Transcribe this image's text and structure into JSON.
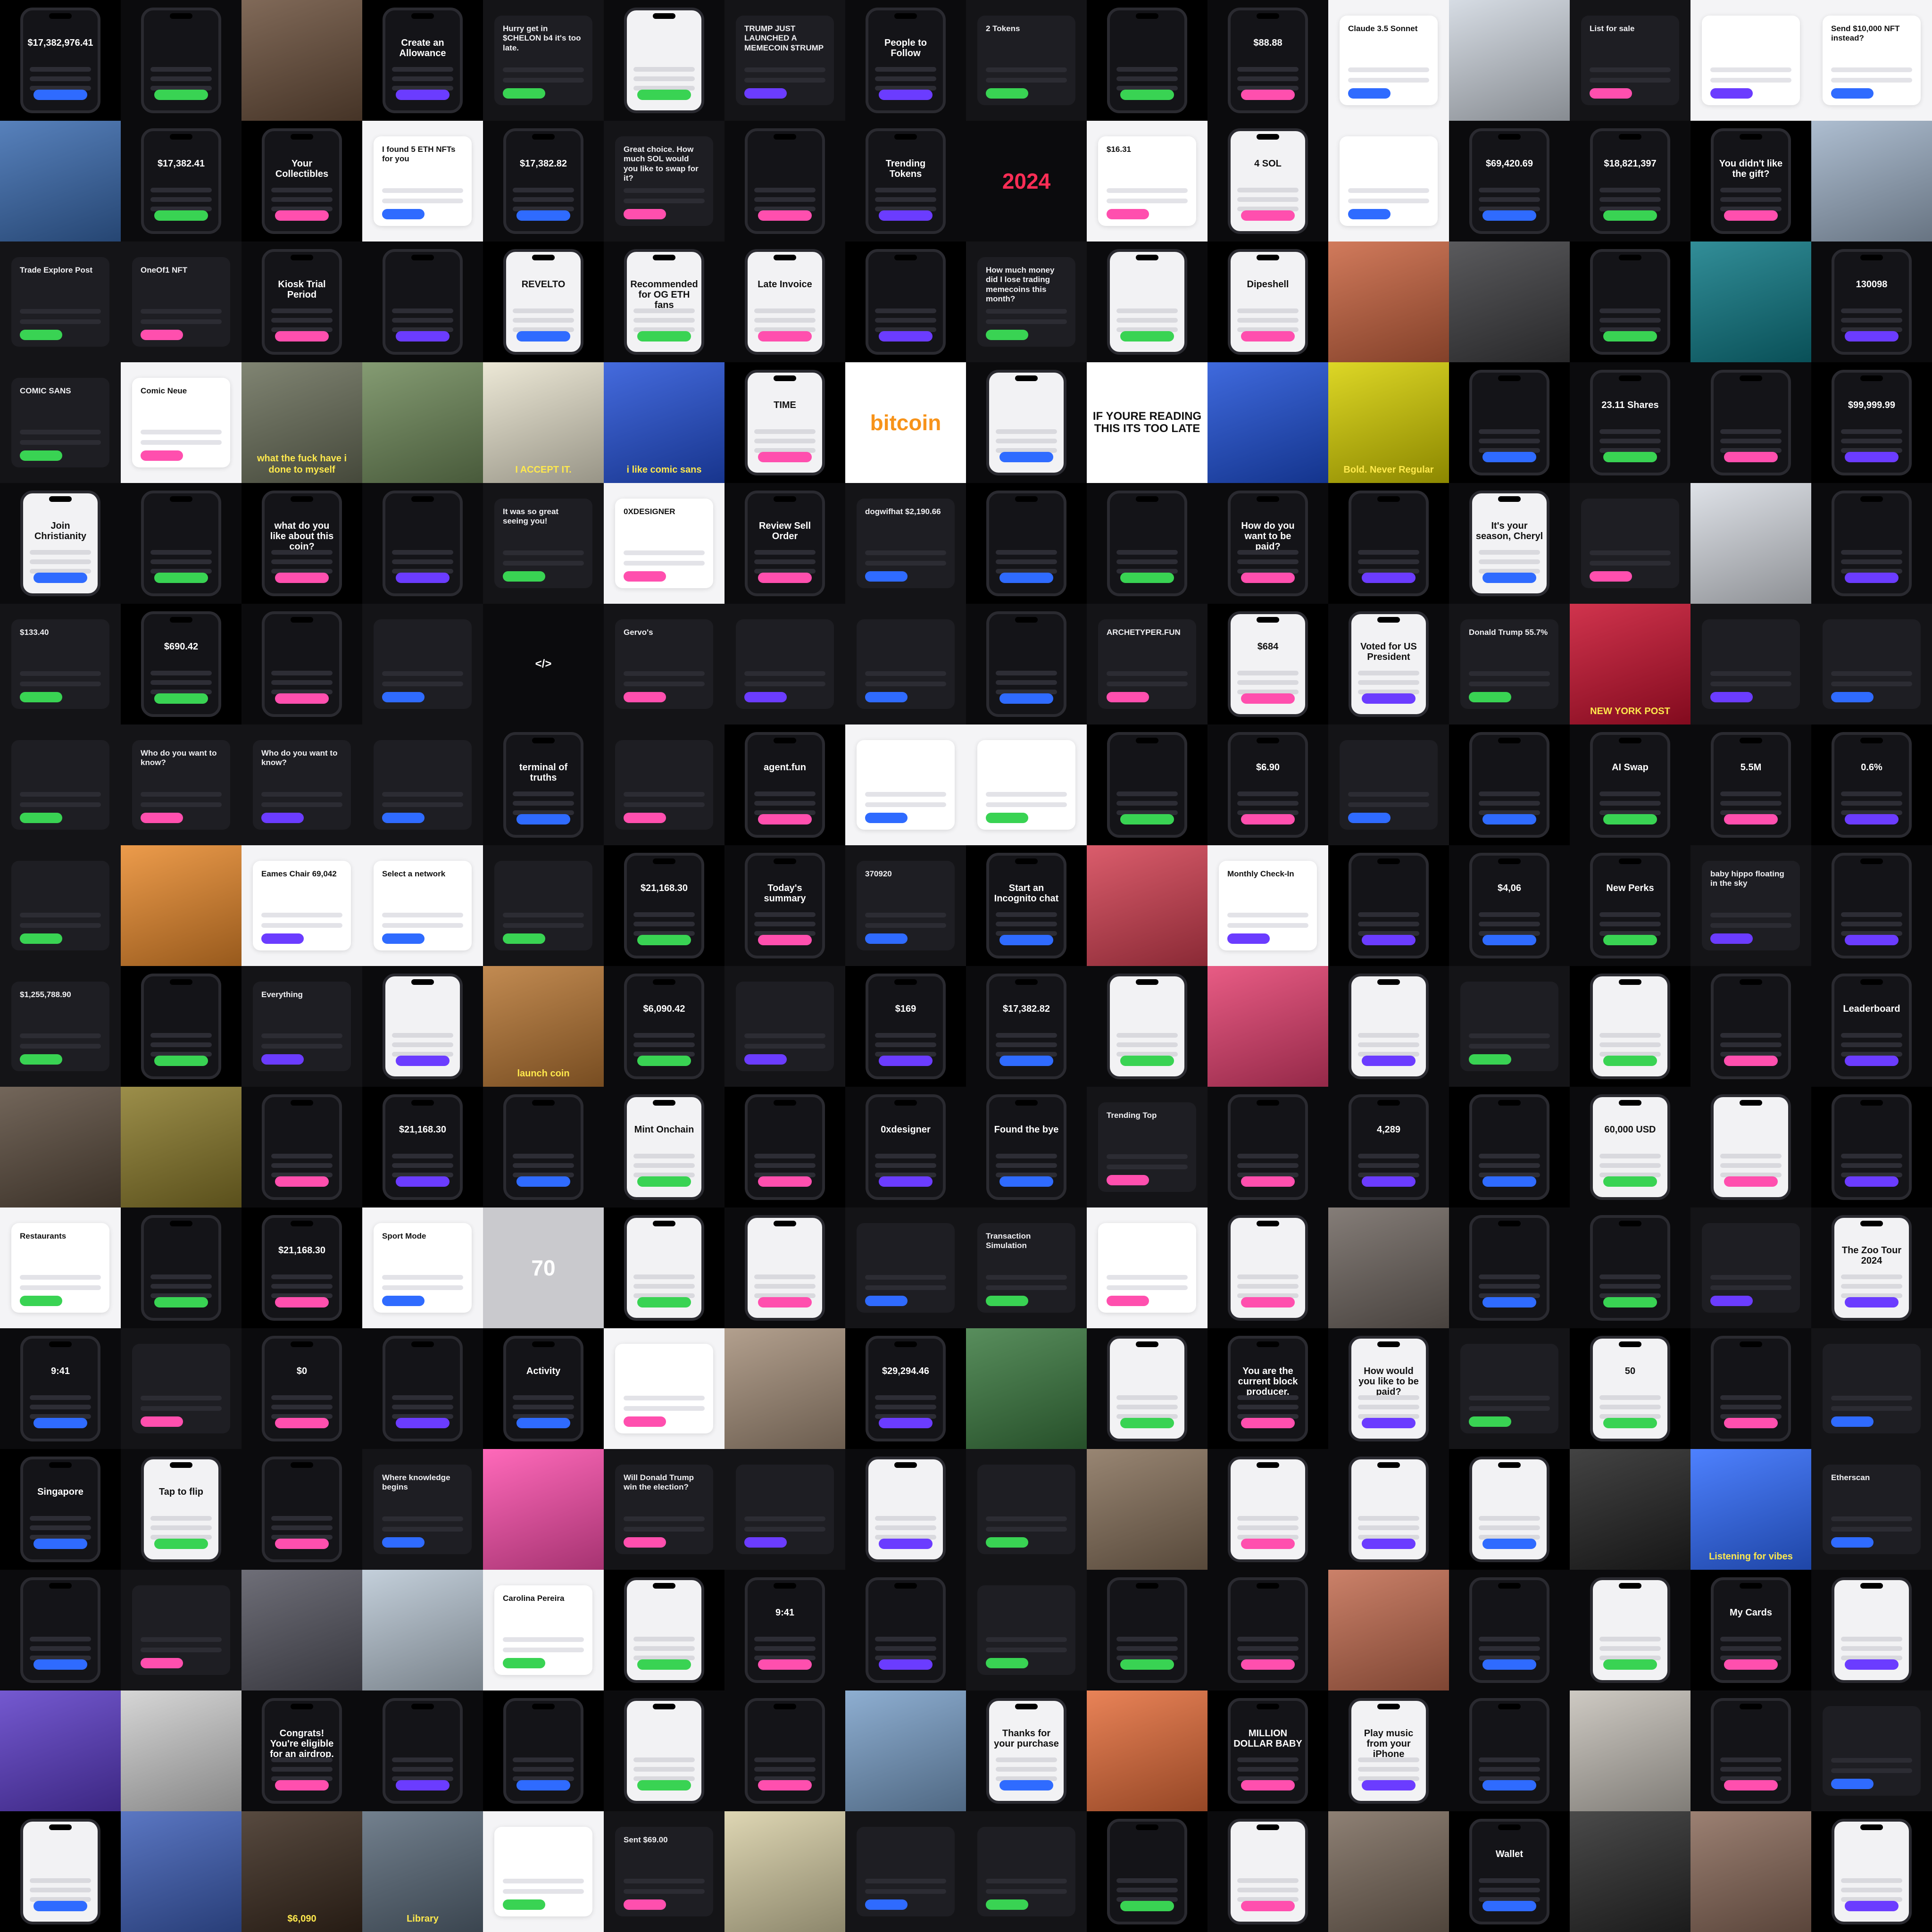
{
  "colors": {
    "background": "#000000",
    "accent_blue": "#2f6bff",
    "accent_green": "#39d353",
    "accent_pink": "#ff4fae",
    "accent_purple": "#6b3cff",
    "accent_orange": "#f7931a"
  },
  "tiles": [
    {
      "style": "phone",
      "text": "$17,382,976.41"
    },
    {
      "style": "phone",
      "text": ""
    },
    {
      "style": "photo",
      "bg": "#6a4f3b",
      "text": ""
    },
    {
      "style": "phone",
      "text": "Create an Allowance"
    },
    {
      "style": "card",
      "text": "Hurry get in $CHELON b4 it's too late."
    },
    {
      "style": "phone-light",
      "text": ""
    },
    {
      "style": "card",
      "text": "TRUMP JUST LAUNCHED A MEMECOIN $TRUMP"
    },
    {
      "style": "phone",
      "text": "People to Follow"
    },
    {
      "style": "card",
      "text": "2 Tokens"
    },
    {
      "style": "phone",
      "text": ""
    },
    {
      "style": "phone",
      "text": "$88.88"
    },
    {
      "style": "card-light",
      "text": "Claude 3.5 Sonnet"
    },
    {
      "style": "photo",
      "bg": "#cfd6df",
      "text": ""
    },
    {
      "style": "card",
      "text": "List for sale"
    },
    {
      "style": "card-light",
      "text": ""
    },
    {
      "style": "card-light",
      "text": "Send $10,000 NFT instead?"
    },
    {
      "style": "photo",
      "bg": "#3a6bb0",
      "text": ""
    },
    {
      "style": "phone",
      "text": "$17,382.41"
    },
    {
      "style": "phone",
      "text": "Your Collectibles"
    },
    {
      "style": "card-light",
      "text": "I found 5 ETH NFTs for you"
    },
    {
      "style": "phone",
      "text": "$17,382.82"
    },
    {
      "style": "card",
      "text": "Great choice. How much SOL would you like to swap for it?"
    },
    {
      "style": "phone",
      "text": ""
    },
    {
      "style": "phone",
      "text": "Trending Tokens"
    },
    {
      "style": "big",
      "color": "#ff2d55",
      "text": "2024"
    },
    {
      "style": "card-light",
      "text": "$16.31"
    },
    {
      "style": "phone-light",
      "text": "4 SOL"
    },
    {
      "style": "card-light",
      "text": ""
    },
    {
      "style": "phone",
      "text": "$69,420.69"
    },
    {
      "style": "phone",
      "text": "$18,821,397"
    },
    {
      "style": "phone",
      "text": "You didn't like the gift?"
    },
    {
      "style": "photo",
      "bg": "#9fb2c8",
      "text": ""
    },
    {
      "style": "card",
      "text": "Trade Explore Post"
    },
    {
      "style": "card",
      "text": "OneOf1 NFT"
    },
    {
      "style": "phone",
      "text": "Kiosk Trial Period"
    },
    {
      "style": "phone",
      "text": ""
    },
    {
      "style": "phone-light",
      "text": "REVELTO"
    },
    {
      "style": "phone-light",
      "text": "Recommended for OG ETH fans"
    },
    {
      "style": "phone-light",
      "text": "Late Invoice"
    },
    {
      "style": "phone",
      "text": ""
    },
    {
      "style": "card",
      "text": "How much money did I lose trading memecoins this month?"
    },
    {
      "style": "phone-light",
      "text": ""
    },
    {
      "style": "phone-light",
      "text": "Dipeshell"
    },
    {
      "style": "photo",
      "bg": "#c9633f",
      "text": ""
    },
    {
      "style": "photo",
      "bg": "#3d3d40",
      "text": ""
    },
    {
      "style": "phone",
      "text": ""
    },
    {
      "style": "photo",
      "bg": "#0e7a86",
      "text": ""
    },
    {
      "style": "phone",
      "text": "130098"
    },
    {
      "style": "card",
      "text": "COMIC SANS"
    },
    {
      "style": "card-light",
      "text": "Comic Neue"
    },
    {
      "style": "photo",
      "bg": "#6a6f5a",
      "text": "what the fuck have i done to myself"
    },
    {
      "style": "photo",
      "bg": "#6f8a5a",
      "text": ""
    },
    {
      "style": "photo",
      "bg": "#e9e4cf",
      "text": "I ACCEPT IT."
    },
    {
      "style": "photo",
      "bg": "#2451d8",
      "text": "i like comic sans"
    },
    {
      "style": "phone-light",
      "text": "TIME"
    },
    {
      "style": "big",
      "color": "#f7931a",
      "bg": "#ffffff",
      "text": "bitcoin"
    },
    {
      "style": "phone-light",
      "text": ""
    },
    {
      "style": "mid",
      "bg": "#ffffff",
      "color": "#111111",
      "text": "IF YOURE READING THIS ITS TOO LATE"
    },
    {
      "style": "photo",
      "bg": "#1e50d8",
      "text": ""
    },
    {
      "style": "photo",
      "bg": "#d7d000",
      "text": "Bold. Never Regular"
    },
    {
      "style": "phone",
      "text": ""
    },
    {
      "style": "phone",
      "text": "23.11 Shares"
    },
    {
      "style": "phone",
      "text": ""
    },
    {
      "style": "phone",
      "text": "$99,999.99"
    },
    {
      "style": "phone-light",
      "text": "Join Christianity"
    },
    {
      "style": "phone",
      "text": ""
    },
    {
      "style": "phone",
      "text": "what do you like about this coin?"
    },
    {
      "style": "phone",
      "text": ""
    },
    {
      "style": "card",
      "text": "It was so great seeing you!"
    },
    {
      "style": "card-light",
      "text": "0XDESIGNER"
    },
    {
      "style": "phone",
      "text": "Review Sell Order"
    },
    {
      "style": "card",
      "text": "dogwifhat $2,190.66"
    },
    {
      "style": "phone",
      "text": ""
    },
    {
      "style": "phone",
      "text": ""
    },
    {
      "style": "phone",
      "text": "How do you want to be paid?"
    },
    {
      "style": "phone",
      "text": ""
    },
    {
      "style": "phone-light",
      "text": "It's your season, Cheryl"
    },
    {
      "style": "card",
      "text": ""
    },
    {
      "style": "photo",
      "bg": "#d9dde4",
      "text": ""
    },
    {
      "style": "phone",
      "text": ""
    },
    {
      "style": "card",
      "text": "$133.40"
    },
    {
      "style": "phone",
      "text": "$690.42"
    },
    {
      "style": "phone",
      "text": ""
    },
    {
      "style": "card",
      "text": ""
    },
    {
      "style": "mid",
      "bg": "#0b0b0d",
      "color": "#ffffff",
      "text": "</>"
    },
    {
      "style": "card",
      "text": "Gervo's"
    },
    {
      "style": "card",
      "text": ""
    },
    {
      "style": "card",
      "text": ""
    },
    {
      "style": "phone",
      "text": ""
    },
    {
      "style": "card",
      "text": "ARCHETYPER.FUN"
    },
    {
      "style": "phone-light",
      "text": "$684"
    },
    {
      "style": "phone-light",
      "text": "Voted for US President"
    },
    {
      "style": "card",
      "text": "Donald Trump 55.7%"
    },
    {
      "style": "photo",
      "bg": "#c8102e",
      "text": "NEW YORK POST"
    },
    {
      "style": "card",
      "text": ""
    },
    {
      "style": "card",
      "text": ""
    },
    {
      "style": "card",
      "text": ""
    },
    {
      "style": "card",
      "text": "Who do you want to know?"
    },
    {
      "style": "card",
      "text": "Who do you want to know?"
    },
    {
      "style": "card",
      "text": ""
    },
    {
      "style": "phone",
      "text": "terminal of truths"
    },
    {
      "style": "card",
      "text": ""
    },
    {
      "style": "phone",
      "text": "agent.fun"
    },
    {
      "style": "card-light",
      "text": ""
    },
    {
      "style": "card-light",
      "text": ""
    },
    {
      "style": "phone",
      "text": ""
    },
    {
      "style": "phone",
      "text": "$6.90"
    },
    {
      "style": "card",
      "text": ""
    },
    {
      "style": "phone",
      "text": ""
    },
    {
      "style": "phone",
      "text": "AI Swap"
    },
    {
      "style": "phone",
      "text": "5.5M"
    },
    {
      "style": "phone",
      "text": "0.6%"
    },
    {
      "style": "card",
      "text": ""
    },
    {
      "style": "photo",
      "bg": "#e98a2c",
      "text": ""
    },
    {
      "style": "card-light",
      "text": "Eames Chair 69,042"
    },
    {
      "style": "card-light",
      "text": "Select a network"
    },
    {
      "style": "card",
      "text": ""
    },
    {
      "style": "phone",
      "text": "$21,168.30"
    },
    {
      "style": "phone",
      "text": "Today's summary"
    },
    {
      "style": "card",
      "text": "370920"
    },
    {
      "style": "phone",
      "text": "Start an Incognito chat"
    },
    {
      "style": "photo",
      "bg": "#d44052",
      "text": ""
    },
    {
      "style": "card-light",
      "text": "Monthly Check-In"
    },
    {
      "style": "phone",
      "text": ""
    },
    {
      "style": "phone",
      "text": "$4,06"
    },
    {
      "style": "phone",
      "text": "New Perks"
    },
    {
      "style": "card",
      "text": "baby hippo floating in the sky"
    },
    {
      "style": "phone",
      "text": ""
    },
    {
      "style": "card",
      "text": "$1,255,788.90"
    },
    {
      "style": "phone",
      "text": ""
    },
    {
      "style": "card",
      "text": "Everything"
    },
    {
      "style": "phone-light",
      "text": ""
    },
    {
      "style": "photo",
      "bg": "#b77633",
      "text": "launch coin"
    },
    {
      "style": "phone",
      "text": "$6,090.42"
    },
    {
      "style": "card",
      "text": ""
    },
    {
      "style": "phone",
      "text": "$169"
    },
    {
      "style": "phone",
      "text": "$17,382.82"
    },
    {
      "style": "phone-light",
      "text": ""
    },
    {
      "style": "photo",
      "bg": "#e43f6f",
      "text": ""
    },
    {
      "style": "phone-light",
      "text": ""
    },
    {
      "style": "card",
      "text": ""
    },
    {
      "style": "phone-light",
      "text": ""
    },
    {
      "style": "phone",
      "text": ""
    },
    {
      "style": "phone",
      "text": "Leaderboard"
    },
    {
      "style": "photo",
      "bg": "#5a4b3d",
      "text": ""
    },
    {
      "style": "photo",
      "bg": "#8a7a2a",
      "text": ""
    },
    {
      "style": "phone",
      "text": ""
    },
    {
      "style": "phone",
      "text": "$21,168.30"
    },
    {
      "style": "phone",
      "text": ""
    },
    {
      "style": "phone-light",
      "text": "Mint Onchain"
    },
    {
      "style": "phone",
      "text": ""
    },
    {
      "style": "phone",
      "text": "0xdesigner"
    },
    {
      "style": "phone",
      "text": "Found the bye"
    },
    {
      "style": "card",
      "text": "Trending Top"
    },
    {
      "style": "phone",
      "text": ""
    },
    {
      "style": "phone",
      "text": "4,289"
    },
    {
      "style": "phone",
      "text": ""
    },
    {
      "style": "phone-light",
      "text": "60,000 USD"
    },
    {
      "style": "phone-light",
      "text": ""
    },
    {
      "style": "phone",
      "text": ""
    },
    {
      "style": "card-light",
      "text": "Restaurants"
    },
    {
      "style": "phone",
      "text": ""
    },
    {
      "style": "phone",
      "text": "$21,168.30"
    },
    {
      "style": "card-light",
      "text": "Sport Mode"
    },
    {
      "style": "big",
      "color": "#ffffff",
      "bg": "#c9c9cd",
      "text": "70"
    },
    {
      "style": "phone-light",
      "text": ""
    },
    {
      "style": "phone-light",
      "text": ""
    },
    {
      "style": "card",
      "text": ""
    },
    {
      "style": "card",
      "text": "Transaction Simulation"
    },
    {
      "style": "card-light",
      "text": ""
    },
    {
      "style": "phone-light",
      "text": ""
    },
    {
      "style": "photo",
      "bg": "#6f6660",
      "text": ""
    },
    {
      "style": "phone",
      "text": ""
    },
    {
      "style": "phone",
      "text": ""
    },
    {
      "style": "card",
      "text": ""
    },
    {
      "style": "phone-light",
      "text": "The Zoo Tour 2024"
    },
    {
      "style": "phone",
      "text": "9:41"
    },
    {
      "style": "card",
      "text": ""
    },
    {
      "style": "phone",
      "text": "$0"
    },
    {
      "style": "phone",
      "text": ""
    },
    {
      "style": "phone",
      "text": "Activity"
    },
    {
      "style": "card-light",
      "text": ""
    },
    {
      "style": "photo",
      "bg": "#a58f7a",
      "text": ""
    },
    {
      "style": "phone",
      "text": "$29,294.46"
    },
    {
      "style": "photo",
      "bg": "#3b7a40",
      "text": ""
    },
    {
      "style": "phone-light",
      "text": ""
    },
    {
      "style": "phone",
      "text": "You are the current block producer."
    },
    {
      "style": "phone-light",
      "text": "How would you like to be paid?"
    },
    {
      "style": "card",
      "text": ""
    },
    {
      "style": "phone-light",
      "text": "50"
    },
    {
      "style": "phone",
      "text": ""
    },
    {
      "style": "card",
      "text": ""
    },
    {
      "style": "phone",
      "text": "Singapore"
    },
    {
      "style": "phone-light",
      "text": "Tap to flip"
    },
    {
      "style": "phone",
      "text": ""
    },
    {
      "style": "card",
      "text": "Where knowledge begins"
    },
    {
      "style": "photo",
      "bg": "#ff4fae",
      "text": ""
    },
    {
      "style": "card",
      "text": "Will Donald Trump win the election?"
    },
    {
      "style": "card",
      "text": ""
    },
    {
      "style": "phone-light",
      "text": ""
    },
    {
      "style": "card",
      "text": ""
    },
    {
      "style": "photo",
      "bg": "#86705a",
      "text": ""
    },
    {
      "style": "phone-light",
      "text": ""
    },
    {
      "style": "phone-light",
      "text": ""
    },
    {
      "style": "phone-light",
      "text": ""
    },
    {
      "style": "photo",
      "bg": "#222222",
      "text": ""
    },
    {
      "style": "photo",
      "bg": "#2f6bff",
      "text": "Listening for vibes"
    },
    {
      "style": "card",
      "text": "Etherscan"
    },
    {
      "style": "phone",
      "text": ""
    },
    {
      "style": "card",
      "text": ""
    },
    {
      "style": "photo",
      "bg": "#555560",
      "text": ""
    },
    {
      "style": "photo",
      "bg": "#b9c7d4",
      "text": ""
    },
    {
      "style": "card-light",
      "text": "Carolina Pereira"
    },
    {
      "style": "phone-light",
      "text": ""
    },
    {
      "style": "phone",
      "text": "9:41"
    },
    {
      "style": "phone",
      "text": ""
    },
    {
      "style": "card",
      "text": ""
    },
    {
      "style": "phone",
      "text": ""
    },
    {
      "style": "phone",
      "text": ""
    },
    {
      "style": "photo",
      "bg": "#c26b4f",
      "text": ""
    },
    {
      "style": "phone",
      "text": ""
    },
    {
      "style": "phone-light",
      "text": ""
    },
    {
      "style": "phone",
      "text": "My Cards"
    },
    {
      "style": "phone-light",
      "text": ""
    },
    {
      "style": "photo",
      "bg": "#5c3cc8",
      "text": ""
    },
    {
      "style": "photo",
      "bg": "#cfcfcf",
      "text": ""
    },
    {
      "style": "phone",
      "text": "Congrats! You're eligible for an airdrop."
    },
    {
      "style": "phone",
      "text": ""
    },
    {
      "style": "phone",
      "text": ""
    },
    {
      "style": "phone-light",
      "text": ""
    },
    {
      "style": "phone",
      "text": ""
    },
    {
      "style": "photo",
      "bg": "#7aa0c9",
      "text": ""
    },
    {
      "style": "phone-light",
      "text": "Thanks for your purchase"
    },
    {
      "style": "photo",
      "bg": "#e56d3a",
      "text": ""
    },
    {
      "style": "phone",
      "text": "MILLION DOLLAR BABY"
    },
    {
      "style": "phone-light",
      "text": "Play music from your iPhone"
    },
    {
      "style": "phone",
      "text": ""
    },
    {
      "style": "photo",
      "bg": "#c5c0b8",
      "text": ""
    },
    {
      "style": "phone",
      "text": ""
    },
    {
      "style": "card",
      "text": ""
    },
    {
      "style": "phone-light",
      "text": ""
    },
    {
      "style": "photo",
      "bg": "#3e5fb8",
      "text": ""
    },
    {
      "style": "photo",
      "bg": "#3a2a1e",
      "text": "$6,090"
    },
    {
      "style": "photo",
      "bg": "#5a6a7a",
      "text": "Library"
    },
    {
      "style": "card-light",
      "text": ""
    },
    {
      "style": "card",
      "text": "Sent $69.00"
    },
    {
      "style": "photo",
      "bg": "#d8cfa6",
      "text": ""
    },
    {
      "style": "card",
      "text": ""
    },
    {
      "style": "card",
      "text": ""
    },
    {
      "style": "phone",
      "text": ""
    },
    {
      "style": "phone-light",
      "text": ""
    },
    {
      "style": "photo",
      "bg": "#7a6a5c",
      "text": ""
    },
    {
      "style": "phone",
      "text": "Wallet"
    },
    {
      "style": "photo",
      "bg": "#2a2a2a",
      "text": ""
    },
    {
      "style": "photo",
      "bg": "#8a6a5a",
      "text": ""
    },
    {
      "style": "phone-light",
      "text": ""
    }
  ]
}
